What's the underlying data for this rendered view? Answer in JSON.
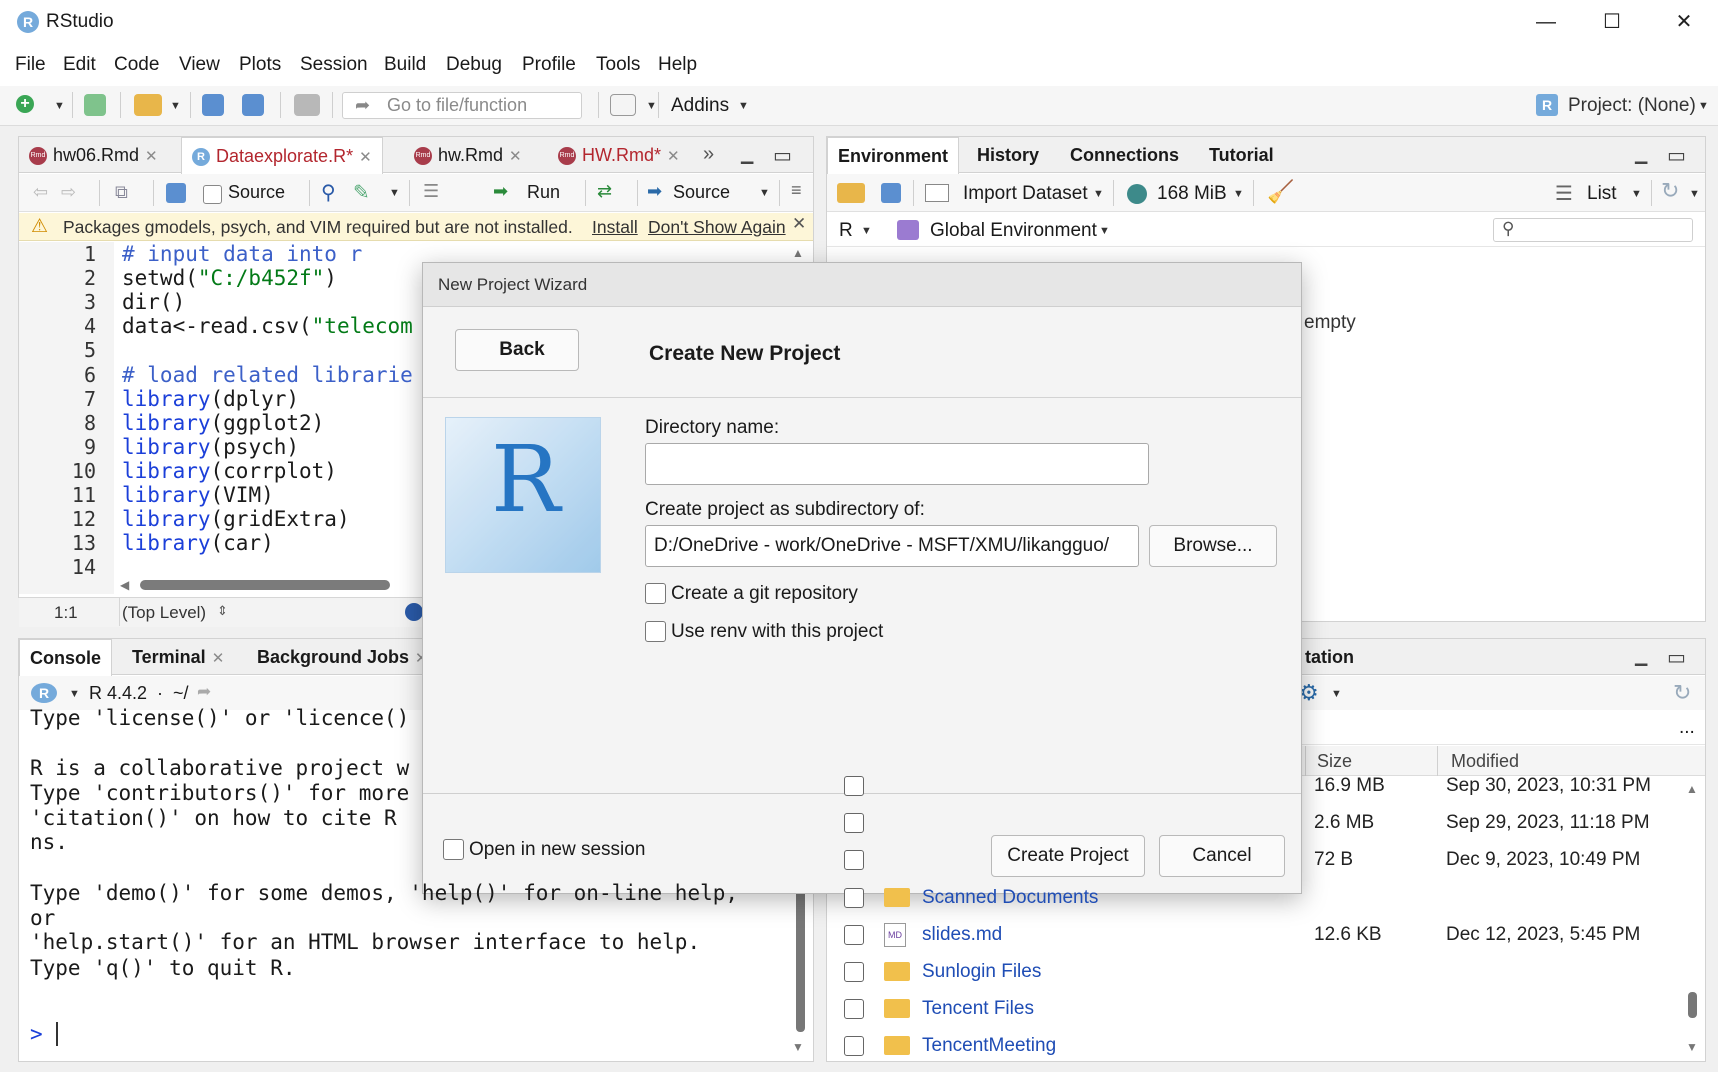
{
  "app": {
    "title": "RStudio",
    "logo_letter": "R"
  },
  "window_controls": {
    "minimize": "—",
    "maximize": "☐",
    "close": "✕"
  },
  "menubar": [
    "File",
    "Edit",
    "Code",
    "View",
    "Plots",
    "Session",
    "Build",
    "Debug",
    "Profile",
    "Tools",
    "Help"
  ],
  "toolbar": {
    "goto_placeholder": "Go to file/function",
    "addins_label": "Addins",
    "project_label": "Project: (None)"
  },
  "editor": {
    "tabs": [
      {
        "label": "hw06.Rmd",
        "icon": "rmd-icon",
        "modified": false
      },
      {
        "label": "Dataexplorate.R*",
        "icon": "r-icon",
        "modified": true,
        "active": true
      },
      {
        "label": "hw.Rmd",
        "icon": "rmd-icon",
        "modified": false
      },
      {
        "label": "HW.Rmd*",
        "icon": "rmd-icon",
        "modified": true
      }
    ],
    "toolbar": {
      "source_on_save_label": "Source",
      "run_label": "Run",
      "source_label": "Source"
    },
    "warning": {
      "text": "Packages gmodels, psych, and VIM required but are not installed.",
      "install_link": "Install",
      "dismiss_link": "Don't Show Again"
    },
    "lines": [
      {
        "num": "1",
        "html": "<span class='cm'># input data into r</span>"
      },
      {
        "num": "2",
        "html": "setwd(<span class='st'>\"C:/b452f\"</span>)"
      },
      {
        "num": "3",
        "html": "dir()"
      },
      {
        "num": "4",
        "html": "data&lt;-read.csv(<span class='st'>\"telecom</span>"
      },
      {
        "num": "5",
        "html": ""
      },
      {
        "num": "6",
        "html": "<span class='cm'># load related librarie</span>"
      },
      {
        "num": "7",
        "html": "<span class='kw'>library</span>(dplyr)"
      },
      {
        "num": "8",
        "html": "<span class='kw'>library</span>(ggplot2)"
      },
      {
        "num": "9",
        "html": "<span class='kw'>library</span>(psych)"
      },
      {
        "num": "10",
        "html": "<span class='kw'>library</span>(corrplot)"
      },
      {
        "num": "11",
        "html": "<span class='kw'>library</span>(VIM)"
      },
      {
        "num": "12",
        "html": "<span class='kw'>library</span>(gridExtra)"
      },
      {
        "num": "13",
        "html": "<span class='kw'>library</span>(car)"
      },
      {
        "num": "14",
        "html": ""
      }
    ],
    "status": {
      "position": "1:1",
      "scope": "(Top Level)"
    }
  },
  "environment": {
    "tabs": [
      "Environment",
      "History",
      "Connections",
      "Tutorial"
    ],
    "import_dataset_label": "Import Dataset",
    "memory_label": "168 MiB",
    "view_mode": "List",
    "language": "R",
    "scope": "Global Environment",
    "empty_text": "empty"
  },
  "console": {
    "tabs": [
      "Console",
      "Terminal",
      "Background Jobs"
    ],
    "r_version": "R 4.4.2",
    "path": "~/",
    "lines": [
      "Type 'license()' or 'licence()",
      "",
      "R is a collaborative project w",
      "Type 'contributors()' for more",
      "'citation()' on how to cite R",
      "ns.",
      "",
      "Type 'demo()' for some demos, 'help()' for on-line help,",
      "or",
      "'help.start()' for an HTML browser interface to help.",
      "Type 'q()' to quit R."
    ],
    "prompt": ">"
  },
  "files": {
    "tab_partial": "tation",
    "more_label": "...",
    "columns": {
      "size": "Size",
      "modified": "Modified"
    },
    "rows": [
      {
        "name": "",
        "type": "file",
        "size": "16.9 MB",
        "modified": "Sep 30, 2023, 10:31 PM"
      },
      {
        "name": "",
        "type": "file",
        "size": "2.6 MB",
        "modified": "Sep 29, 2023, 11:18 PM"
      },
      {
        "name": "",
        "type": "file",
        "size": "72 B",
        "modified": "Dec 9, 2023, 10:49 PM"
      },
      {
        "name": "Scanned Documents",
        "type": "folder",
        "size": "",
        "modified": ""
      },
      {
        "name": "slides.md",
        "type": "md",
        "size": "12.6 KB",
        "modified": "Dec 12, 2023, 5:45 PM"
      },
      {
        "name": "Sunlogin Files",
        "type": "folder",
        "size": "",
        "modified": ""
      },
      {
        "name": "Tencent Files",
        "type": "folder",
        "size": "",
        "modified": ""
      },
      {
        "name": "TencentMeeting",
        "type": "folder",
        "size": "",
        "modified": ""
      }
    ]
  },
  "dialog": {
    "window_title": "New Project Wizard",
    "back_label": "Back",
    "heading": "Create New Project",
    "dir_name_label": "Directory name:",
    "dir_name_value": "",
    "subdir_label": "Create project as subdirectory of:",
    "subdir_value": "D:/OneDrive - work/OneDrive - MSFT/XMU/likangguo/",
    "browse_label": "Browse...",
    "git_label": "Create a git repository",
    "git_checked": false,
    "renv_label": "Use renv with this project",
    "renv_checked": false,
    "new_session_label": "Open in new session",
    "new_session_checked": false,
    "create_label": "Create Project",
    "cancel_label": "Cancel",
    "logo_letter": "R"
  },
  "colors": {
    "accent_blue": "#75aadb",
    "link_blue": "#1f4db5",
    "warning_bg": "#fdf6d8",
    "code_keyword": "#1b3fd9",
    "code_string": "#037a17"
  }
}
